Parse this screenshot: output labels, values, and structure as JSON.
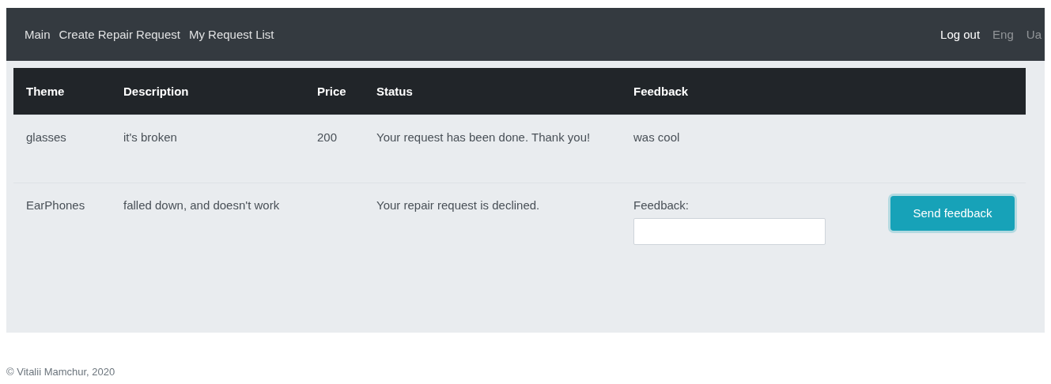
{
  "navbar": {
    "links": [
      {
        "label": "Main"
      },
      {
        "label": "Create Repair Request"
      },
      {
        "label": "My Request List"
      }
    ],
    "right": [
      {
        "label": "Log out",
        "kind": "action"
      },
      {
        "label": "Eng",
        "kind": "language"
      },
      {
        "label": "Ua",
        "kind": "language"
      }
    ]
  },
  "table": {
    "columns": [
      "Theme",
      "Description",
      "Price",
      "Status",
      "Feedback"
    ],
    "rows": [
      {
        "theme": "glasses",
        "description": "it's broken",
        "price": "200",
        "status": "Your request has been done. Thank you!",
        "feedback": {
          "kind": "text",
          "text": "was cool"
        }
      },
      {
        "theme": "EarPhones",
        "description": "falled down, and doesn't work",
        "status": "Your repair request is declined.",
        "feedback": {
          "kind": "form",
          "label": "Feedback:",
          "button": "Send feedback"
        }
      }
    ]
  },
  "footer": "© Vitalii Mamchur, 2020"
}
